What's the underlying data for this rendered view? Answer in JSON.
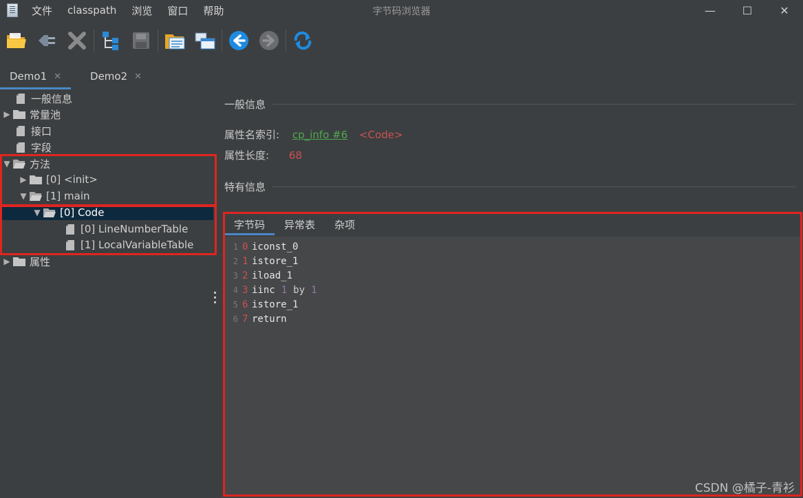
{
  "window": {
    "title": "字节码浏览器",
    "menu": [
      "文件",
      "classpath",
      "浏览",
      "窗口",
      "帮助"
    ],
    "controls": {
      "minimize": "—",
      "maximize": "☐",
      "close": "✕"
    }
  },
  "toolbar": {
    "buttons": [
      "open-folder-icon",
      "plug-icon",
      "delete-icon",
      "tree-icon",
      "save-icon",
      "folder-list-icon",
      "window-icon",
      "back-icon",
      "forward-icon",
      "refresh-icon"
    ]
  },
  "tabs": [
    {
      "label": "Demo1",
      "close": "✕",
      "active": true
    },
    {
      "label": "Demo2",
      "close": "✕",
      "active": false
    }
  ],
  "tree": {
    "nodes": [
      {
        "label": "一般信息",
        "icon": "file-icon",
        "arrow": ""
      },
      {
        "label": "常量池",
        "icon": "folder-icon",
        "arrow": "▶"
      },
      {
        "label": "接口",
        "icon": "file-icon",
        "arrow": ""
      },
      {
        "label": "字段",
        "icon": "file-icon",
        "arrow": ""
      },
      {
        "label": "方法",
        "icon": "folder-open-icon",
        "arrow": "▼"
      },
      {
        "label": "[0] <init>",
        "icon": "folder-icon",
        "arrow": "▶"
      },
      {
        "label": "[1] main",
        "icon": "folder-open-icon",
        "arrow": "▼"
      },
      {
        "label": "[0] Code",
        "icon": "folder-open-icon",
        "arrow": "▼",
        "selected": true
      },
      {
        "label": "[0] LineNumberTable",
        "icon": "file-icon",
        "arrow": ""
      },
      {
        "label": "[1] LocalVariableTable",
        "icon": "file-icon",
        "arrow": ""
      },
      {
        "label": "属性",
        "icon": "folder-icon",
        "arrow": "▶"
      }
    ]
  },
  "detail": {
    "general_title": "一般信息",
    "attr_name_label": "属性名索引:",
    "attr_name_link": "cp_info #6",
    "attr_name_value": "<Code>",
    "attr_len_label": "属性长度:",
    "attr_len_value": "68",
    "specific_title": "特有信息",
    "inner_tabs": [
      "字节码",
      "异常表",
      "杂项"
    ]
  },
  "bytecode": [
    {
      "line": "1",
      "offset": "0",
      "op": "iconst_0",
      "args": []
    },
    {
      "line": "2",
      "offset": "1",
      "op": "istore_1",
      "args": []
    },
    {
      "line": "3",
      "offset": "2",
      "op": "iload_1",
      "args": []
    },
    {
      "line": "4",
      "offset": "3",
      "op": "iinc",
      "args": [
        "1",
        "by",
        "1"
      ]
    },
    {
      "line": "5",
      "offset": "6",
      "op": "istore_1",
      "args": []
    },
    {
      "line": "6",
      "offset": "7",
      "op": "return",
      "args": []
    }
  ],
  "watermark": "CSDN @橘子-青衫",
  "colors": {
    "accent": "#4a88c7",
    "highlight": "#e0251f",
    "link": "#4ea84e",
    "value": "#cc5151",
    "number": "#9876aa"
  }
}
